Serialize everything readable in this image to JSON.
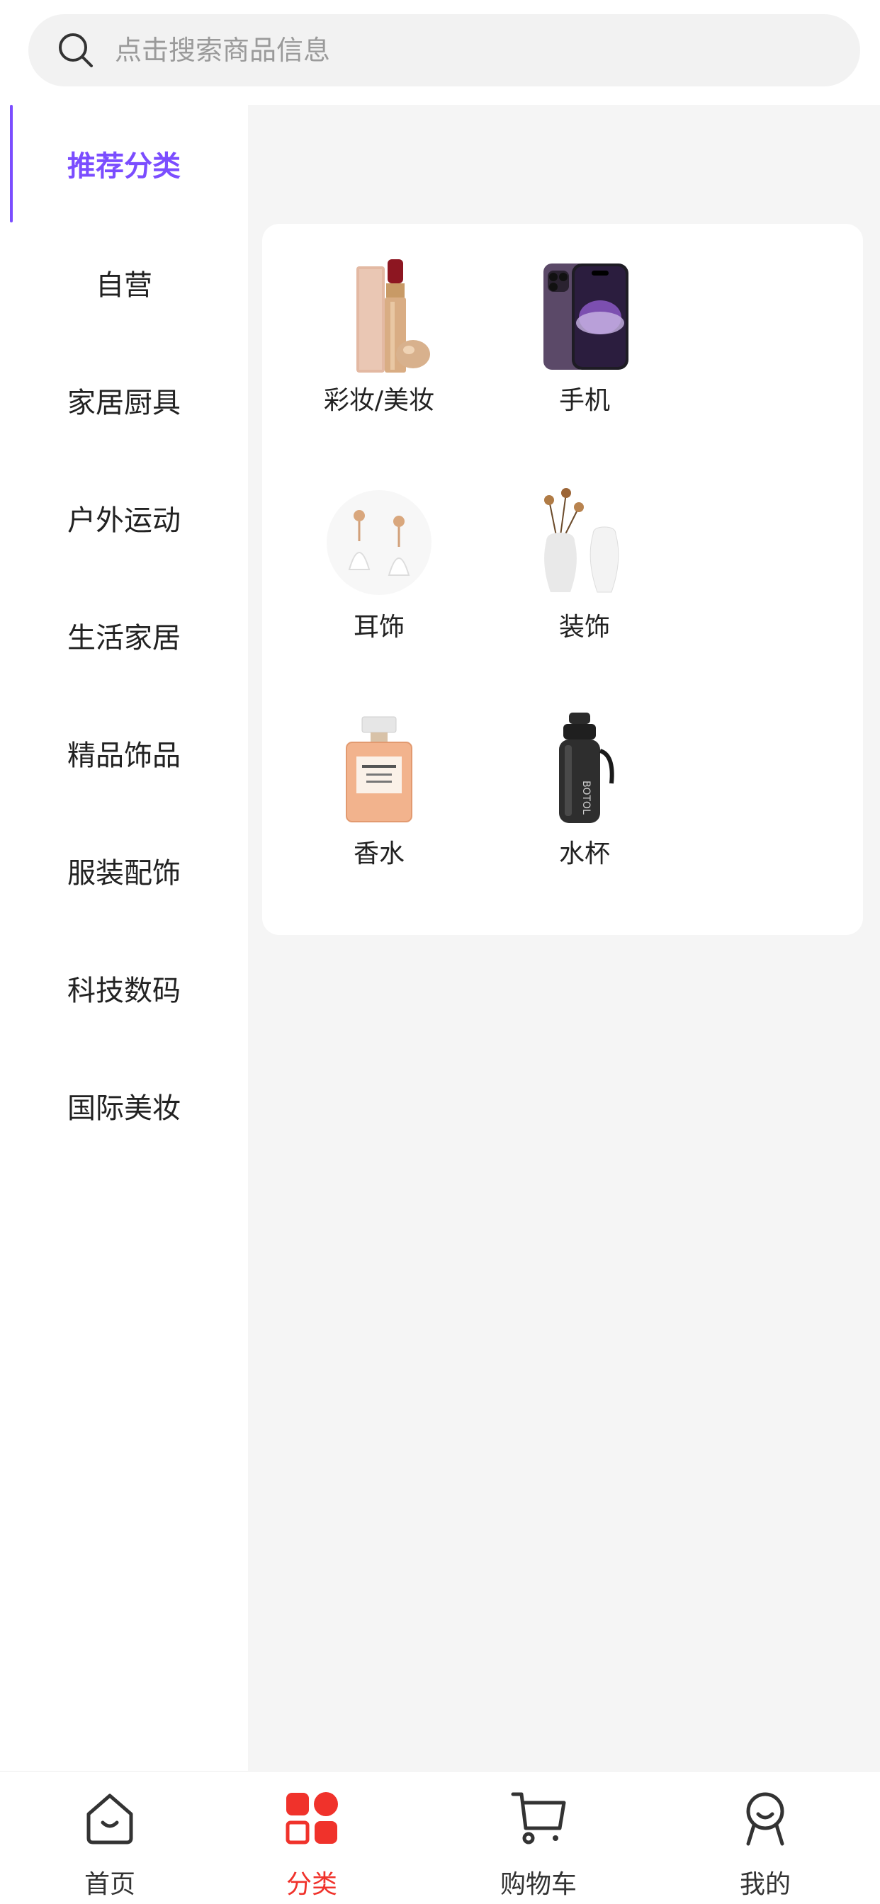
{
  "search": {
    "placeholder": "点击搜索商品信息",
    "icon": "search-icon"
  },
  "sidebar": {
    "items": [
      {
        "label": "推荐分类",
        "active": true
      },
      {
        "label": "自营"
      },
      {
        "label": "家居厨具"
      },
      {
        "label": "户外运动"
      },
      {
        "label": "生活家居"
      },
      {
        "label": "精品饰品"
      },
      {
        "label": "服装配饰"
      },
      {
        "label": "科技数码"
      },
      {
        "label": "国际美妆"
      }
    ],
    "active_color": "#7b4dff"
  },
  "categories": [
    {
      "label": "彩妆/美妆",
      "icon": "lipstick-image"
    },
    {
      "label": "手机",
      "icon": "phone-image"
    },
    {
      "label": "耳饰",
      "icon": "earrings-image"
    },
    {
      "label": "装饰",
      "icon": "vase-image"
    },
    {
      "label": "香水",
      "icon": "perfume-image"
    },
    {
      "label": "水杯",
      "icon": "water-bottle-image"
    }
  ],
  "tabbar": {
    "items": [
      {
        "label": "首页",
        "icon": "home-icon"
      },
      {
        "label": "分类",
        "icon": "category-icon",
        "active": true
      },
      {
        "label": "购物车",
        "icon": "cart-icon"
      },
      {
        "label": "我的",
        "icon": "profile-icon"
      }
    ],
    "active_color": "#f0322b"
  }
}
